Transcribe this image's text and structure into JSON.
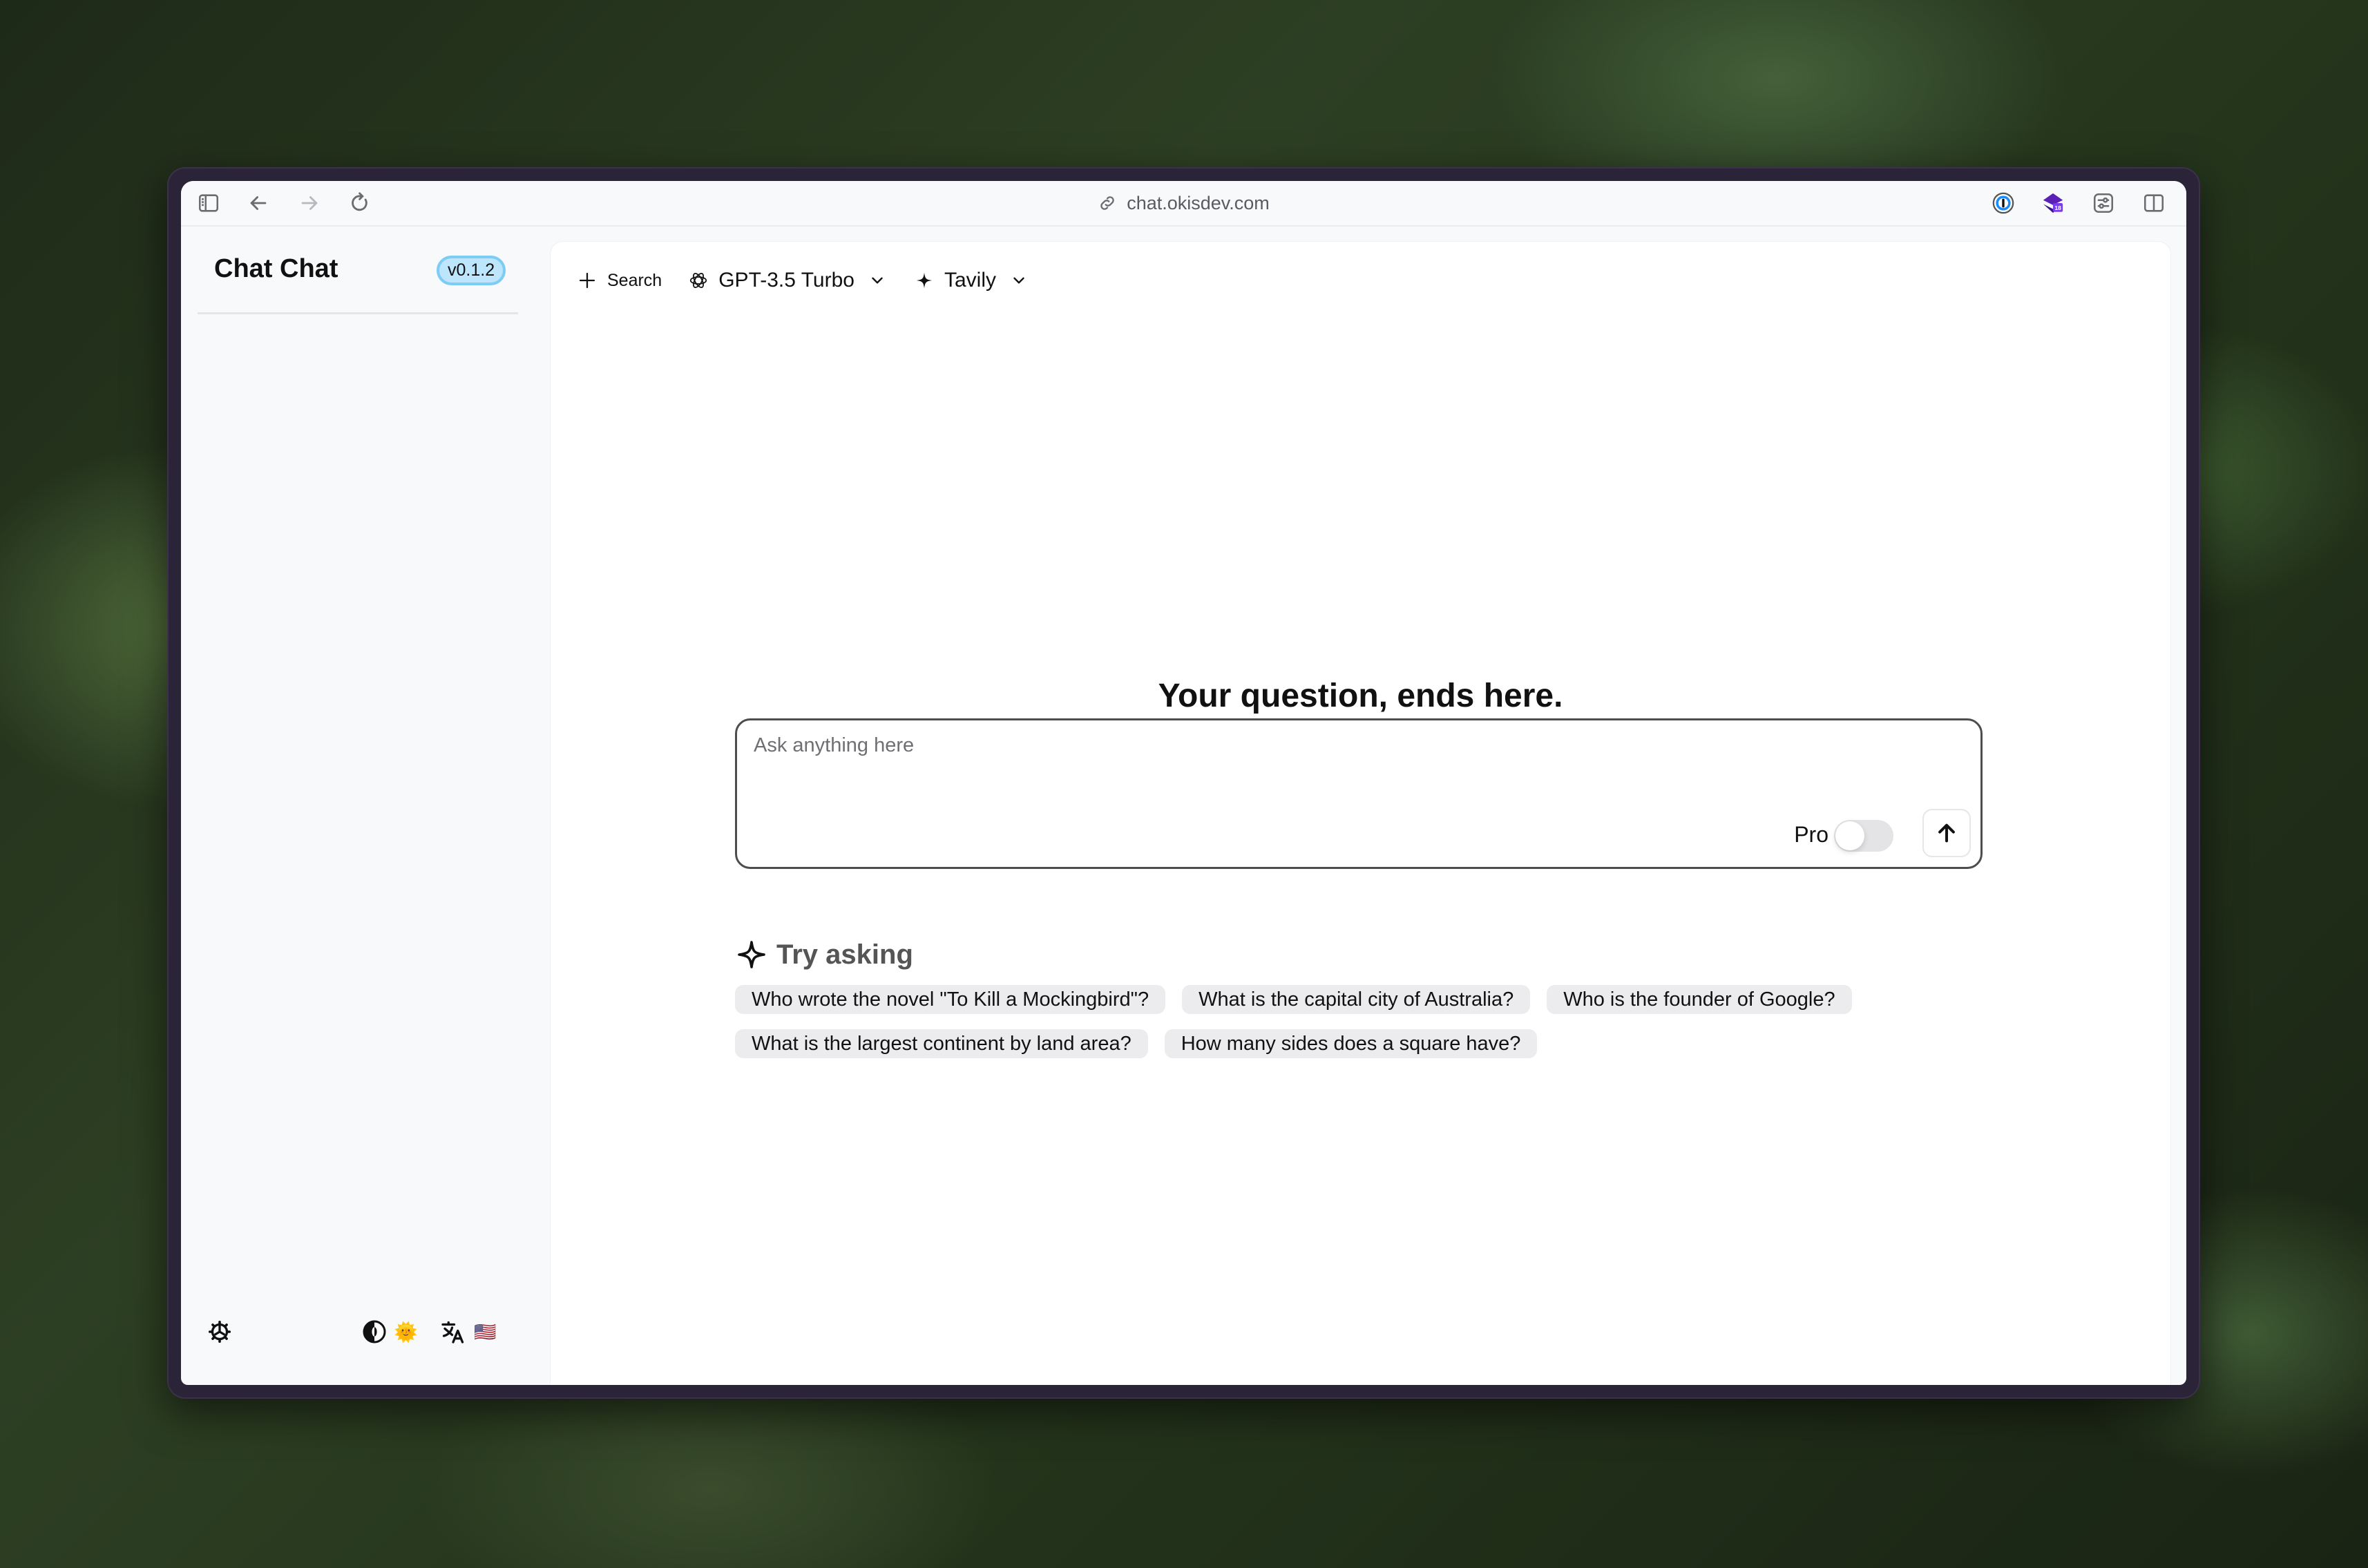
{
  "browser": {
    "url": "chat.okisdev.com",
    "icons": [
      "sidebar-toggle-icon",
      "back-arrow-icon",
      "forward-arrow-icon",
      "reload-icon",
      "link-icon",
      "password-manager-icon",
      "extension-icon",
      "filter-settings-icon",
      "split-view-icon"
    ],
    "extension_badge": "18",
    "colors": {
      "frame": "#2b2338",
      "window": "#f8f9fb",
      "password_manager": "#1a8cff",
      "extension": "#5b21b6"
    }
  },
  "sidebar": {
    "brand": "Chat Chat",
    "version": "v0.1.2",
    "bottom": {
      "settings_icon": "gear-icon",
      "theme_icon": "contrast-icon",
      "theme_value": "🌞",
      "language_icon": "translate-icon",
      "language_value": "🇺🇸"
    }
  },
  "topbar": {
    "new_search_label": "Search",
    "model_label": "GPT-3.5 Turbo",
    "search_provider_label": "Tavily"
  },
  "main": {
    "heading": "Your question, ends here.",
    "input": {
      "placeholder": "Ask anything here",
      "value": "",
      "pro_label": "Pro",
      "pro_enabled": false
    },
    "try_asking": {
      "title": "Try asking",
      "suggestions": [
        "Who wrote the novel \"To Kill a Mockingbird\"?",
        "What is the capital city of Australia?",
        "Who is the founder of Google?",
        "What is the largest continent by land area?",
        "How many sides does a square have?"
      ]
    }
  }
}
